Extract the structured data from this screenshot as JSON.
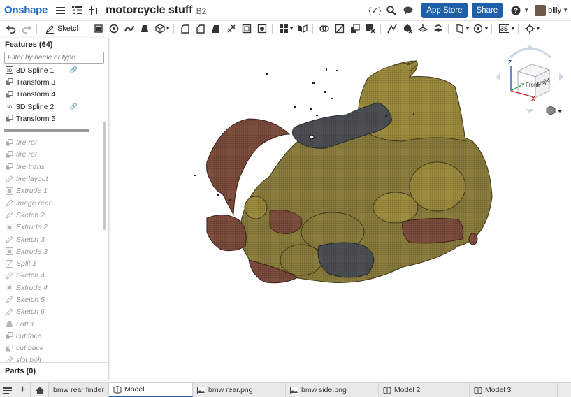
{
  "header": {
    "logo": "Onshape",
    "doc_title": "motorcycle stuff",
    "version": "B2",
    "app_store": "App Store",
    "share": "Share",
    "user": "billy"
  },
  "toolbar": {
    "sketch_label": "Sketch",
    "threads_label": "3S"
  },
  "features": {
    "title": "Features (64)",
    "filter_placeholder": "Filter by name or type",
    "active": [
      {
        "label": "3D Spline 1",
        "icon": "spline-icon",
        "linked": true
      },
      {
        "label": "Transform 3",
        "icon": "transform-icon",
        "linked": false
      },
      {
        "label": "Transform 4",
        "icon": "transform-icon",
        "linked": false
      },
      {
        "label": "3D Spline 2",
        "icon": "spline-icon",
        "linked": true
      },
      {
        "label": "Transform 5",
        "icon": "transform-icon",
        "linked": false
      }
    ],
    "rolled_back": [
      {
        "label": "tire rot",
        "icon": "transform-icon"
      },
      {
        "label": "tire rot",
        "icon": "transform-icon"
      },
      {
        "label": "tire trans",
        "icon": "transform-icon"
      },
      {
        "label": "tire layout",
        "icon": "sketch-icon"
      },
      {
        "label": "Extrude 1",
        "icon": "extrude-icon"
      },
      {
        "label": "image rear",
        "icon": "sketch-icon"
      },
      {
        "label": "Sketch 2",
        "icon": "sketch-icon"
      },
      {
        "label": "Extrude 2",
        "icon": "extrude-icon"
      },
      {
        "label": "Sketch 3",
        "icon": "sketch-icon"
      },
      {
        "label": "Extrude 3",
        "icon": "extrude-icon"
      },
      {
        "label": "Split 1",
        "icon": "split-icon"
      },
      {
        "label": "Sketch 4",
        "icon": "sketch-icon"
      },
      {
        "label": "Extrude 4",
        "icon": "extrude-icon"
      },
      {
        "label": "Sketch 5",
        "icon": "sketch-icon"
      },
      {
        "label": "Sketch 6",
        "icon": "sketch-icon"
      },
      {
        "label": "Loft 1",
        "icon": "loft-icon"
      },
      {
        "label": "cut face",
        "icon": "transform-icon"
      },
      {
        "label": "cut back",
        "icon": "transform-icon"
      },
      {
        "label": "slot bolt",
        "icon": "sketch-icon"
      }
    ],
    "parts": "Parts (0)"
  },
  "viewcube": {
    "front": "Front",
    "right": "Right",
    "axis_x": "X",
    "axis_y": "Y",
    "axis_z": "Z"
  },
  "tabs": [
    {
      "label": "bmw rear finder",
      "icon": "folder-icon",
      "active": false
    },
    {
      "label": "Model",
      "icon": "part-studio-icon",
      "active": true
    },
    {
      "label": "bmw rear.png",
      "icon": "image-icon",
      "active": false
    },
    {
      "label": "bmw side.png",
      "icon": "image-icon",
      "active": false
    },
    {
      "label": "Model 2",
      "icon": "part-studio-icon",
      "active": false
    },
    {
      "label": "Model 3",
      "icon": "part-studio-icon",
      "active": false
    }
  ],
  "colors": {
    "brand": "#1e6ac0",
    "button": "#1f5fa8",
    "mesh_olive": "#8a7a3a",
    "mesh_rust": "#7a4a3a",
    "mesh_gray": "#4a4e52"
  }
}
